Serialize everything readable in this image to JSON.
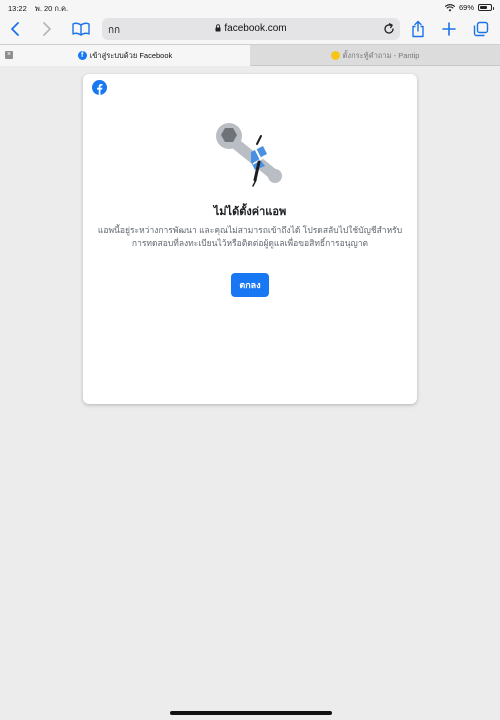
{
  "status_bar": {
    "time": "13:22",
    "date": "พ. 20 ก.ค.",
    "battery_percent": "69%",
    "battery_level": 0.69
  },
  "toolbar": {
    "reader_label": "กก",
    "url": "facebook.com",
    "icons": [
      "back-icon",
      "forward-icon",
      "bookmarks-icon",
      "lock-icon",
      "reload-icon",
      "share-icon",
      "new-tab-icon",
      "tabs-overview-icon"
    ]
  },
  "tabs": [
    {
      "label": "เข้าสู่ระบบด้วย Facebook",
      "active": true
    },
    {
      "label": "ตั้งกระทู้คำถาม - Pantip",
      "active": false
    }
  ],
  "dialog": {
    "title": "ไม่ได้ตั้งค่าแอพ",
    "message": "แอพนี้อยู่ระหว่างการพัฒนา และคุณไม่สามารถเข้าถึงได้ โปรดสลับไปใช้บัญชีสำหรับการทดสอบที่ลงทะเบียนไว้หรือติดต่อผู้ดูแลเพื่อขอสิทธิ์การอนุญาต",
    "ok_label": "ตกลง"
  },
  "colors": {
    "accent": "#1877f2",
    "background": "#ececec"
  }
}
